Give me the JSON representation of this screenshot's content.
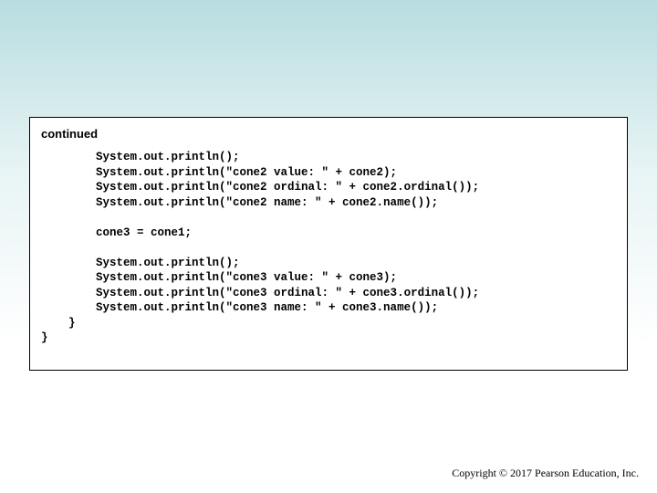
{
  "heading": "continued",
  "code": "        System.out.println();\n        System.out.println(\"cone2 value: \" + cone2);\n        System.out.println(\"cone2 ordinal: \" + cone2.ordinal());\n        System.out.println(\"cone2 name: \" + cone2.name());\n\n        cone3 = cone1;\n\n        System.out.println();\n        System.out.println(\"cone3 value: \" + cone3);\n        System.out.println(\"cone3 ordinal: \" + cone3.ordinal());\n        System.out.println(\"cone3 name: \" + cone3.name());\n    }\n}",
  "copyright": "Copyright © 2017 Pearson Education, Inc."
}
